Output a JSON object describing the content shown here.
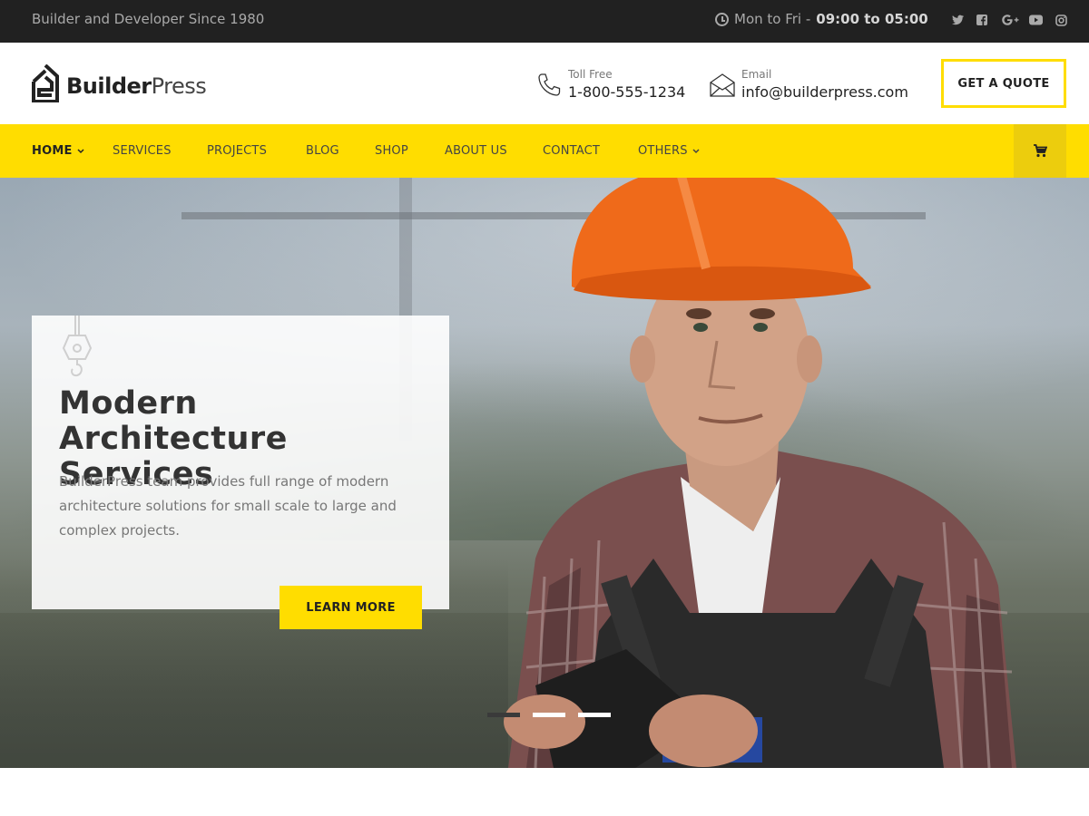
{
  "topbar": {
    "tagline": "Builder and Developer Since 1980",
    "hours_prefix": "Mon to Fri -",
    "hours_time": "09:00 to 05:00",
    "social": [
      "twitter-icon",
      "facebook-icon",
      "google-plus-icon",
      "youtube-icon",
      "instagram-icon"
    ]
  },
  "header": {
    "logo_bold": "Builder",
    "logo_light": "Press",
    "phone_label": "Toll Free",
    "phone_value": "1-800-555-1234",
    "email_label": "Email",
    "email_value": "info@builderpress.com",
    "quote_label": "GET A QUOTE"
  },
  "nav": {
    "items": [
      {
        "label": "HOME"
      },
      {
        "label": "SERVICES"
      },
      {
        "label": "PROJECTS"
      },
      {
        "label": "BLOG"
      },
      {
        "label": "SHOP"
      },
      {
        "label": "ABOUT US"
      },
      {
        "label": "CONTACT"
      },
      {
        "label": "OTHERS"
      }
    ],
    "cart_icon": "cart-icon"
  },
  "hero": {
    "title": "Modern Architecture Services",
    "description": "BuilderPress team provides full range of modern architecture solutions for small scale to large and complex projects.",
    "button_label": "LEARN MORE",
    "slides": 3,
    "active_slide": 1
  },
  "colors": {
    "accent": "#ffdd00",
    "topbar": "#212121",
    "text_dark": "#222222"
  }
}
